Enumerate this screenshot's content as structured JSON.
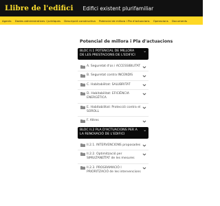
{
  "header": {
    "title": "Llibre de l'edifici",
    "subtitle": "Edifici existent plurifamiliar"
  },
  "nav": {
    "items": [
      "Agents",
      "Dades administratives i jurídiques",
      "Descripció constructiva",
      "Potencial de millora i Pla d'actuacions",
      "Operacions",
      "Documents"
    ]
  },
  "main": {
    "title": "Potencial de millora i Pla d'actuacions",
    "blocs": [
      {
        "label": "BLOC II.1 POTENCIAL DE MILLORA DE LES PRESTACIONS DE L'EDIFICI",
        "items": [
          "A. Seguretat d'ús i ACCESSIBILITAT",
          "B. Seguretat contra INCENDIS",
          "C. Habitabilitat: SALUBRITAT",
          "D. Habitabilitat: EFICIÈNCIA ENERGÈTICA",
          "E. Habitabilitat: Protecció contra el SOROLL",
          "F. Altres"
        ]
      },
      {
        "label": "BLOC II.2 PLA D'ACTUACIONS PER A LA RENOVACIÓ DE L'EDIFICI",
        "items": [
          "II.2.1. INTERVENCIONS proposades",
          "II.2.2. Optimització per SIMULTANEÏTAT de les mesures",
          "II.2.3. PROGRAMACIÓ I PRIORITZACIÓ de les intervencions"
        ]
      }
    ]
  },
  "icons": {
    "folder": "folder-icon",
    "chevron": "chevron-down-icon"
  },
  "colors": {
    "header_bg": "#111111",
    "title_yellow": "#fedf2e",
    "nav_bg": "#fed826",
    "bloc_bg": "#0a0a0a",
    "icon_gray": "#8a8a8a"
  }
}
